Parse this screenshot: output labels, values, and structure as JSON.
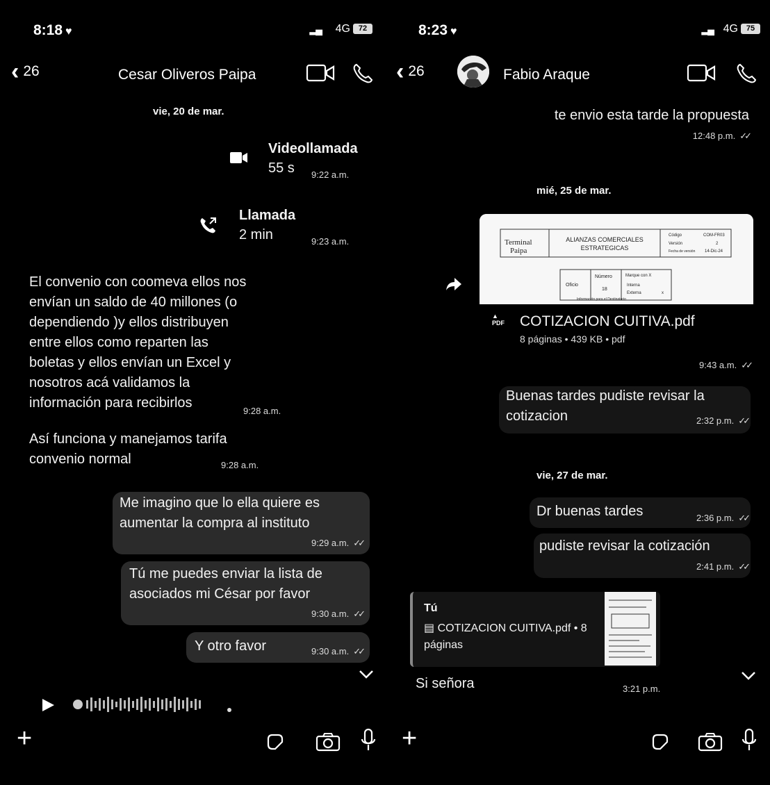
{
  "left": {
    "status": {
      "time": "8:18",
      "network": "4G",
      "battery": "72"
    },
    "header": {
      "back_count": "26",
      "contact_name": "Cesar Oliveros Paipa"
    },
    "date1": "vie, 20 de mar.",
    "video_call": {
      "title": "Videollamada",
      "duration": "55 s",
      "time": "9:22 a.m."
    },
    "voice_call": {
      "title": "Llamada",
      "duration": "2 min",
      "time": "9:23 a.m."
    },
    "msg1": {
      "lines": [
        "El convenio con coomeva ellos nos",
        "envían un saldo de 40 millones (o",
        "dependiendo )y ellos distribuyen",
        "entre ellos como reparten las",
        "boletas y ellos envían un Excel y",
        "nosotros acá validamos la",
        "información para recibirlos"
      ],
      "time": "9:28 a.m."
    },
    "msg2": {
      "lines": [
        "Así funciona y manejamos tarifa",
        "convenio normal"
      ],
      "time": "9:28 a.m."
    },
    "msg3": {
      "lines": [
        "Me imagino que lo ella quiere es",
        "aumentar la compra al instituto"
      ],
      "time": "9:29 a.m."
    },
    "msg4": {
      "lines": [
        "Tú me puedes enviar la lista de",
        "asociados mi César por favor"
      ],
      "time": "9:30 a.m."
    },
    "msg5": {
      "text": "Y otro favor",
      "time": "9:30 a.m."
    }
  },
  "right": {
    "status": {
      "time": "8:23",
      "network": "4G",
      "battery": "75"
    },
    "header": {
      "back_count": "26",
      "contact_name": "Fabio Araque"
    },
    "msg0": {
      "text": "te envio esta tarde la propuesta",
      "time": "12:48 p.m."
    },
    "date1": "mié, 25 de mar.",
    "doc": {
      "filename": "COTIZACION CUITIVA.pdf",
      "meta": "8 páginas • 439 KB • pdf",
      "time": "9:43 a.m.",
      "preview": {
        "logo_top": "Terminal",
        "logo_bottom": "Paipa",
        "heading_1": "ALIANZAS COMERCIALES",
        "heading_2": "ESTRATEGICAS",
        "codigo_label": "Código",
        "codigo_value": "COM-FR03",
        "version_label": "Versión",
        "version_value": "2",
        "fecha_label": "Fecha de versión",
        "fecha_value": "14-Dic-24",
        "oficio": "Oficio",
        "numero": "Número",
        "numero_value": "18",
        "marque": "Marque con X",
        "interna": "Interna",
        "externa": "Externa",
        "externa_mark": "x",
        "info": "Información para el Destinatario"
      }
    },
    "msg1": {
      "lines": [
        "Buenas tardes pudiste revisar la",
        "cotizacion"
      ],
      "time": "2:32 p.m."
    },
    "date2": "vie, 27 de mar.",
    "msg2": {
      "text": "Dr buenas tardes",
      "time": "2:36 p.m."
    },
    "msg3": {
      "text": "pudiste revisar la cotización",
      "time": "2:41 p.m."
    },
    "reply": {
      "author": "Tú",
      "quoted_line1": "COTIZACION CUITIVA.pdf • 8",
      "quoted_line2": "páginas",
      "text": "Si señora",
      "time": "3:21 p.m."
    }
  },
  "colors": {
    "background": "#000000",
    "bubble": "#2b2b2b",
    "text": "#ffffff"
  }
}
